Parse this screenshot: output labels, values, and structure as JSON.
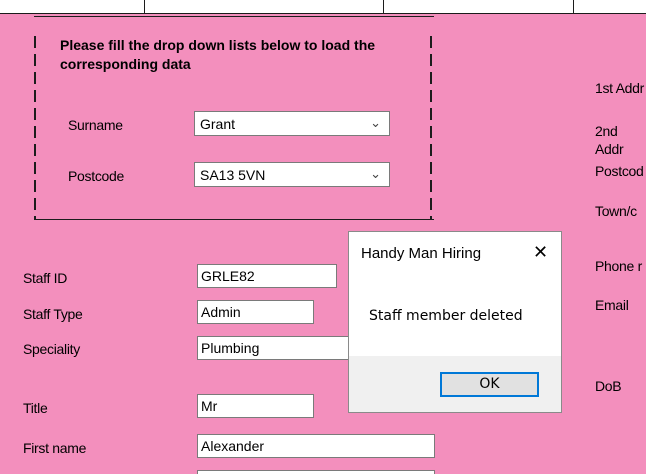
{
  "group": {
    "title": "Please fill the drop down lists below to load the corresponding data",
    "surname_label": "Surname",
    "surname_value": "Grant",
    "postcode_label": "Postcode",
    "postcode_value": "SA13 5VN",
    "dropdown_icon": "chevron-down"
  },
  "form": {
    "staff_id_label": "Staff ID",
    "staff_id_value": "GRLE82",
    "staff_type_label": "Staff Type",
    "staff_type_value": "Admin",
    "speciality_label": "Speciality",
    "speciality_value": "Plumbing",
    "title_label": "Title",
    "title_value": "Mr",
    "first_name_label": "First name",
    "first_name_value": "Alexander"
  },
  "right": {
    "address1_label": "1st Addr",
    "address2_label": "2nd Addr",
    "postcode_label": "Postcod",
    "town_label": "Town/c",
    "phone_label": "Phone r",
    "email_label": "Email",
    "dob_label": "DoB"
  },
  "dialog": {
    "title": "Handy Man Hiring",
    "close_icon": "close-icon",
    "message": "Staff member deleted",
    "ok_label": "OK"
  },
  "colors": {
    "background": "#f38fbd",
    "ok_border": "#0078d7"
  }
}
